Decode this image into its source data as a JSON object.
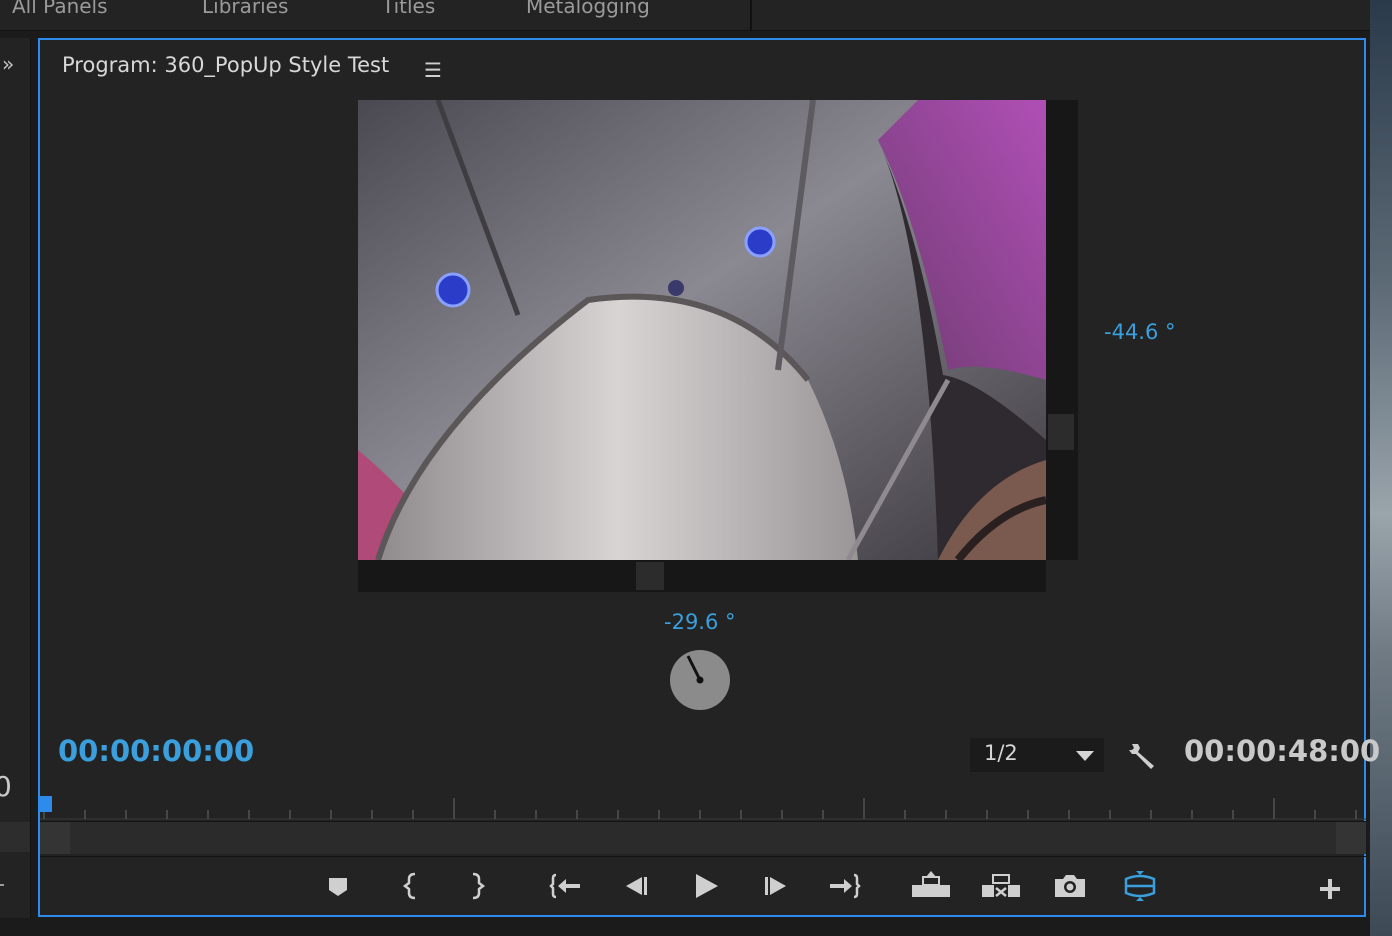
{
  "top_tabs": [
    "All Panels",
    "Libraries",
    "Titles",
    "Metalogging"
  ],
  "panel": {
    "title": "Program: 360_PopUp Style Test",
    "menu_icon": "hamburger-menu-icon",
    "expand_icon": "double-chevron-right-icon"
  },
  "vr": {
    "vertical_angle": "-44.6 °",
    "horizontal_angle": "-29.6 °"
  },
  "timecodes": {
    "current": "00:00:00:00",
    "duration": "00:00:48:00",
    "left_partial": "0"
  },
  "resolution": {
    "selected": "1/2"
  },
  "accent_color": "#2d8ceb",
  "timecode_color": "#3a9fdc",
  "transport_buttons": [
    {
      "name": "add-marker-button",
      "icon": "marker-icon"
    },
    {
      "name": "mark-in-button",
      "icon": "mark-in-icon"
    },
    {
      "name": "mark-out-button",
      "icon": "mark-out-icon"
    },
    {
      "name": "go-to-in-button",
      "icon": "go-to-in-icon"
    },
    {
      "name": "step-back-button",
      "icon": "step-back-icon"
    },
    {
      "name": "play-button",
      "icon": "play-icon"
    },
    {
      "name": "step-forward-button",
      "icon": "step-forward-icon"
    },
    {
      "name": "go-to-out-button",
      "icon": "go-to-out-icon"
    },
    {
      "name": "lift-button",
      "icon": "lift-icon"
    },
    {
      "name": "extract-button",
      "icon": "extract-icon"
    },
    {
      "name": "export-frame-button",
      "icon": "camera-icon"
    },
    {
      "name": "vr-video-toggle-button",
      "icon": "vr-video-icon"
    },
    {
      "name": "button-editor-button",
      "icon": "plus-icon"
    }
  ]
}
